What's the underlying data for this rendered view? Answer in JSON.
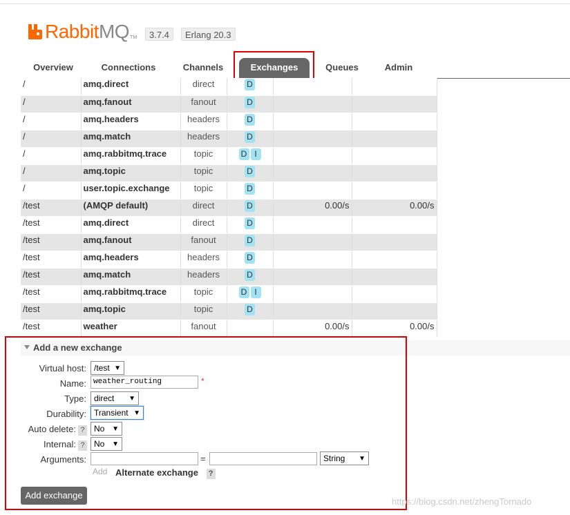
{
  "header": {
    "logo": {
      "rabbit": "Rabbit",
      "mq": "MQ",
      "tm": "TM"
    },
    "version": "3.7.4",
    "erlang": "Erlang 20.3"
  },
  "tabs": [
    {
      "label": "Overview",
      "active": false
    },
    {
      "label": "Connections",
      "active": false
    },
    {
      "label": "Channels",
      "active": false
    },
    {
      "label": "Exchanges",
      "active": true
    },
    {
      "label": "Queues",
      "active": false
    },
    {
      "label": "Admin",
      "active": false
    }
  ],
  "exchanges": [
    {
      "vhost": "/",
      "name": "amq.direct",
      "type": "direct",
      "features": [
        "D"
      ],
      "rate_in": "",
      "rate_out": ""
    },
    {
      "vhost": "/",
      "name": "amq.fanout",
      "type": "fanout",
      "features": [
        "D"
      ],
      "rate_in": "",
      "rate_out": ""
    },
    {
      "vhost": "/",
      "name": "amq.headers",
      "type": "headers",
      "features": [
        "D"
      ],
      "rate_in": "",
      "rate_out": ""
    },
    {
      "vhost": "/",
      "name": "amq.match",
      "type": "headers",
      "features": [
        "D"
      ],
      "rate_in": "",
      "rate_out": ""
    },
    {
      "vhost": "/",
      "name": "amq.rabbitmq.trace",
      "type": "topic",
      "features": [
        "D",
        "I"
      ],
      "rate_in": "",
      "rate_out": ""
    },
    {
      "vhost": "/",
      "name": "amq.topic",
      "type": "topic",
      "features": [
        "D"
      ],
      "rate_in": "",
      "rate_out": ""
    },
    {
      "vhost": "/",
      "name": "user.topic.exchange",
      "type": "topic",
      "features": [
        "D"
      ],
      "rate_in": "",
      "rate_out": ""
    },
    {
      "vhost": "/test",
      "name": "(AMQP default)",
      "type": "direct",
      "features": [
        "D"
      ],
      "rate_in": "0.00/s",
      "rate_out": "0.00/s"
    },
    {
      "vhost": "/test",
      "name": "amq.direct",
      "type": "direct",
      "features": [
        "D"
      ],
      "rate_in": "",
      "rate_out": ""
    },
    {
      "vhost": "/test",
      "name": "amq.fanout",
      "type": "fanout",
      "features": [
        "D"
      ],
      "rate_in": "",
      "rate_out": ""
    },
    {
      "vhost": "/test",
      "name": "amq.headers",
      "type": "headers",
      "features": [
        "D"
      ],
      "rate_in": "",
      "rate_out": ""
    },
    {
      "vhost": "/test",
      "name": "amq.match",
      "type": "headers",
      "features": [
        "D"
      ],
      "rate_in": "",
      "rate_out": ""
    },
    {
      "vhost": "/test",
      "name": "amq.rabbitmq.trace",
      "type": "topic",
      "features": [
        "D",
        "I"
      ],
      "rate_in": "",
      "rate_out": ""
    },
    {
      "vhost": "/test",
      "name": "amq.topic",
      "type": "topic",
      "features": [
        "D"
      ],
      "rate_in": "",
      "rate_out": ""
    },
    {
      "vhost": "/test",
      "name": "weather",
      "type": "fanout",
      "features": [],
      "rate_in": "0.00/s",
      "rate_out": "0.00/s"
    }
  ],
  "form": {
    "title": "Add a new exchange",
    "labels": {
      "vhost": "Virtual host:",
      "name": "Name:",
      "type": "Type:",
      "durability": "Durability:",
      "auto_delete": "Auto delete:",
      "internal": "Internal:",
      "arguments": "Arguments:"
    },
    "help": "?",
    "required_mark": "*",
    "vhost_value": "/test",
    "name_value": "weather_routing",
    "type_value": "direct",
    "durability_value": "Transient",
    "auto_delete_value": "No",
    "internal_value": "No",
    "arg_key": "",
    "arg_equals": "=",
    "arg_value": "",
    "arg_type": "String",
    "add_link": "Add",
    "alternate_exchange": "Alternate exchange",
    "submit": "Add exchange"
  },
  "watermark": "https://blog.csdn.net/zhengTornado",
  "colors": {
    "brand": "#ff6600",
    "active_tab": "#666666",
    "feature_badge": "#a3e2f2",
    "highlight": "#e00000"
  }
}
